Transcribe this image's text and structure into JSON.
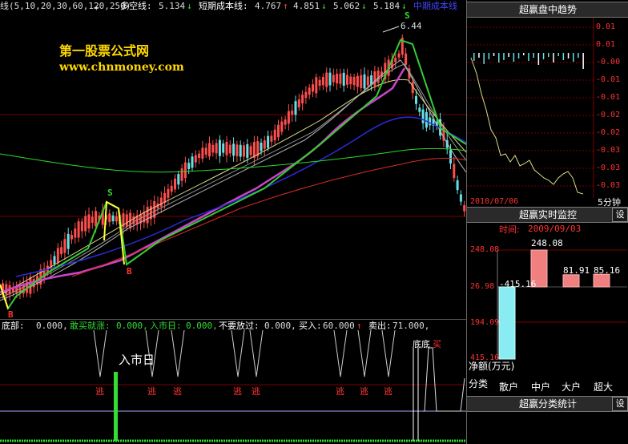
{
  "colors": {
    "up": "#ff4d4d",
    "down": "#66e0e6",
    "accent": "#ffd700",
    "grid_red": "#7a0000"
  },
  "main": {
    "ma_params": "线(5,10,20,30,60,120,250)",
    "duokong_label": "多空线:",
    "duokong_value": "5.134",
    "duokong_arrow": "↓",
    "short_cost_label": "短期成本线:",
    "v1": "4.767",
    "a1": "↑",
    "v2": "4.851",
    "a2": "↓",
    "v3": "5.062",
    "a3": "↓",
    "v4": "5.184",
    "a4": "↓",
    "mid_cost_label": "中期成本线",
    "watermark_cn": "第一股票公式网",
    "watermark_url": "www.chnmoney.com",
    "peak_label": "6.44",
    "signal_s": "S",
    "signal_b": "B"
  },
  "indicator": {
    "l1": "底部:",
    "v1": "0.000,",
    "l2": "敢买就涨:",
    "v2": "0.000,",
    "l3": "入市日:",
    "v3": "0.000,",
    "l4": "不要放过:",
    "v4": "0.000,",
    "l5": "买入:",
    "v5": "60.000",
    "a5": "↑",
    "l6": "卖出:",
    "v6": "71.000,"
  },
  "sub": {
    "rushi": "入市日",
    "tao": "逃",
    "didi": "底底",
    "mai": "买"
  },
  "panel_trend": {
    "title": "超赢盘中趋势",
    "date": "2010/07/06",
    "period": "5分钟",
    "axis": [
      "0.01",
      "0.01",
      "-0.00",
      "-0.01",
      "-0.01",
      "-0.02",
      "-0.02",
      "-0.03",
      "-0.03",
      "-0.03"
    ]
  },
  "panel_monitor": {
    "title": "超赢实时监控",
    "settings": "设",
    "time_label": "时间:",
    "time_value": "2009/09/03",
    "axis_top": "248.08",
    "axis_mid": "26.98",
    "axis_2": "194.09",
    "axis_3": "415.16",
    "values": [
      "415.16",
      "248.08",
      "81.91",
      "85.16"
    ],
    "net_label": "净额(万元)",
    "category_label": "分类",
    "categories": [
      "散户",
      "中户",
      "大户",
      "超大"
    ]
  },
  "panel_stats": {
    "title": "超赢分类统计",
    "settings": "设"
  }
}
